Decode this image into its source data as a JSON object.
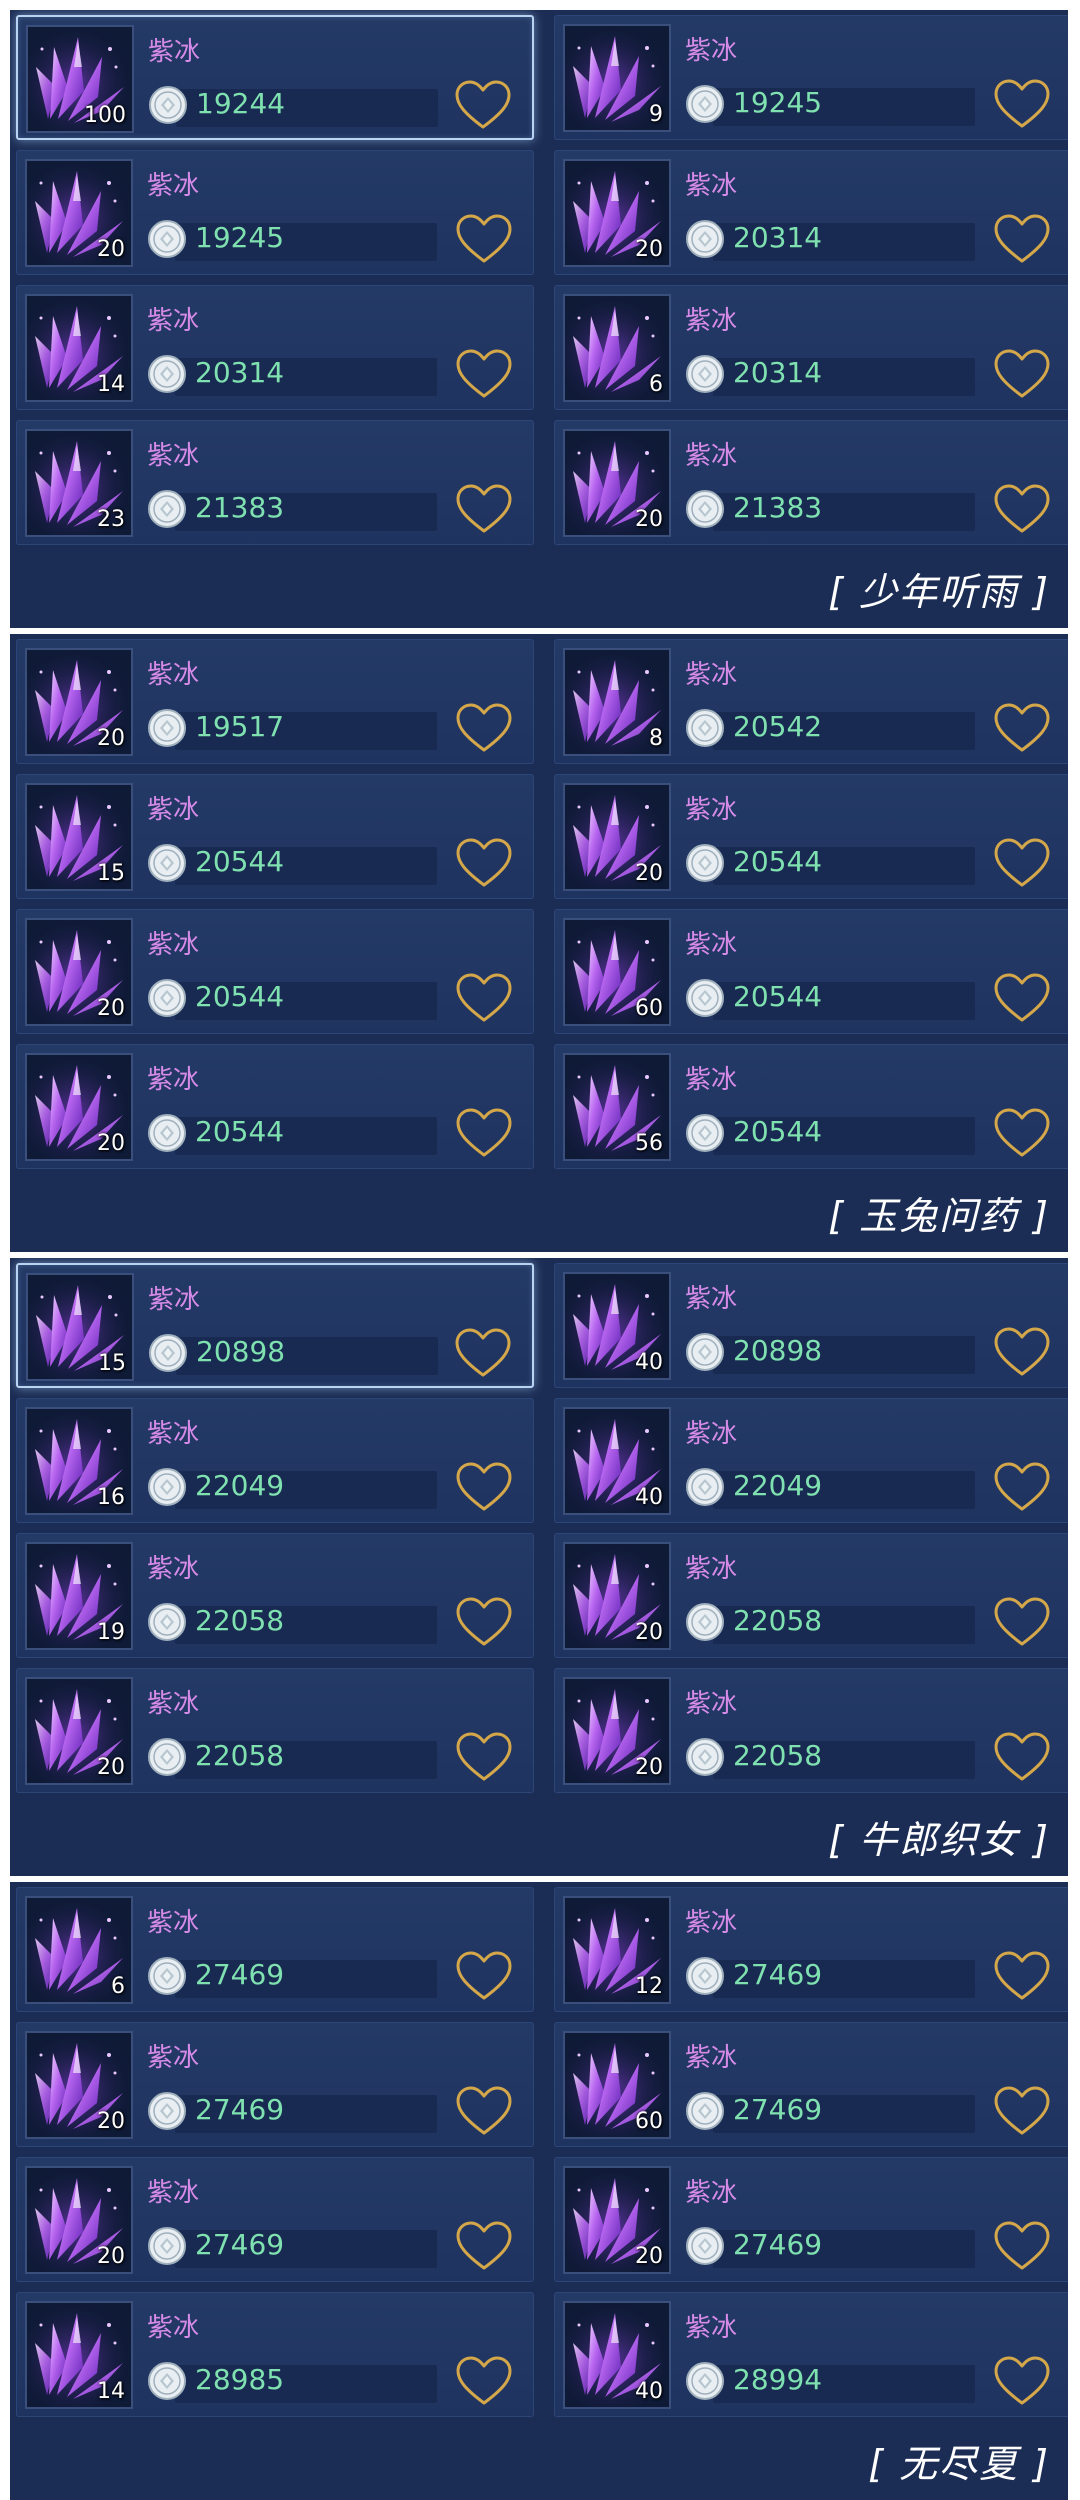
{
  "icons": {
    "item": "purple-crystal-icon",
    "currency": "silver-coin-icon",
    "favorite": "heart-outline-icon"
  },
  "colors": {
    "item_name": "#d78be8",
    "price": "#7fe0b0",
    "panel_bg": "#1c2d55",
    "heart": "#d4a84a"
  },
  "panels": [
    {
      "server": "[ 少年听雨 ]",
      "items": [
        {
          "name": "紫冰",
          "qty": "100",
          "price": "19244",
          "selected": true
        },
        {
          "name": "紫冰",
          "qty": "9",
          "price": "19245"
        },
        {
          "name": "紫冰",
          "qty": "20",
          "price": "19245"
        },
        {
          "name": "紫冰",
          "qty": "20",
          "price": "20314"
        },
        {
          "name": "紫冰",
          "qty": "14",
          "price": "20314"
        },
        {
          "name": "紫冰",
          "qty": "6",
          "price": "20314"
        },
        {
          "name": "紫冰",
          "qty": "23",
          "price": "21383"
        },
        {
          "name": "紫冰",
          "qty": "20",
          "price": "21383"
        }
      ]
    },
    {
      "server": "[ 玉兔问药 ]",
      "items": [
        {
          "name": "紫冰",
          "qty": "20",
          "price": "19517"
        },
        {
          "name": "紫冰",
          "qty": "8",
          "price": "20542"
        },
        {
          "name": "紫冰",
          "qty": "15",
          "price": "20544"
        },
        {
          "name": "紫冰",
          "qty": "20",
          "price": "20544"
        },
        {
          "name": "紫冰",
          "qty": "20",
          "price": "20544"
        },
        {
          "name": "紫冰",
          "qty": "60",
          "price": "20544"
        },
        {
          "name": "紫冰",
          "qty": "20",
          "price": "20544"
        },
        {
          "name": "紫冰",
          "qty": "56",
          "price": "20544"
        }
      ]
    },
    {
      "server": "[ 牛郎织女 ]",
      "items": [
        {
          "name": "紫冰",
          "qty": "15",
          "price": "20898",
          "selected": true
        },
        {
          "name": "紫冰",
          "qty": "40",
          "price": "20898"
        },
        {
          "name": "紫冰",
          "qty": "16",
          "price": "22049"
        },
        {
          "name": "紫冰",
          "qty": "40",
          "price": "22049"
        },
        {
          "name": "紫冰",
          "qty": "19",
          "price": "22058"
        },
        {
          "name": "紫冰",
          "qty": "20",
          "price": "22058"
        },
        {
          "name": "紫冰",
          "qty": "20",
          "price": "22058"
        },
        {
          "name": "紫冰",
          "qty": "20",
          "price": "22058"
        }
      ]
    },
    {
      "server": "[ 无尽夏 ]",
      "items": [
        {
          "name": "紫冰",
          "qty": "6",
          "price": "27469"
        },
        {
          "name": "紫冰",
          "qty": "12",
          "price": "27469"
        },
        {
          "name": "紫冰",
          "qty": "20",
          "price": "27469"
        },
        {
          "name": "紫冰",
          "qty": "60",
          "price": "27469"
        },
        {
          "name": "紫冰",
          "qty": "20",
          "price": "27469"
        },
        {
          "name": "紫冰",
          "qty": "20",
          "price": "27469"
        },
        {
          "name": "紫冰",
          "qty": "14",
          "price": "28985"
        },
        {
          "name": "紫冰",
          "qty": "40",
          "price": "28994"
        }
      ]
    }
  ]
}
